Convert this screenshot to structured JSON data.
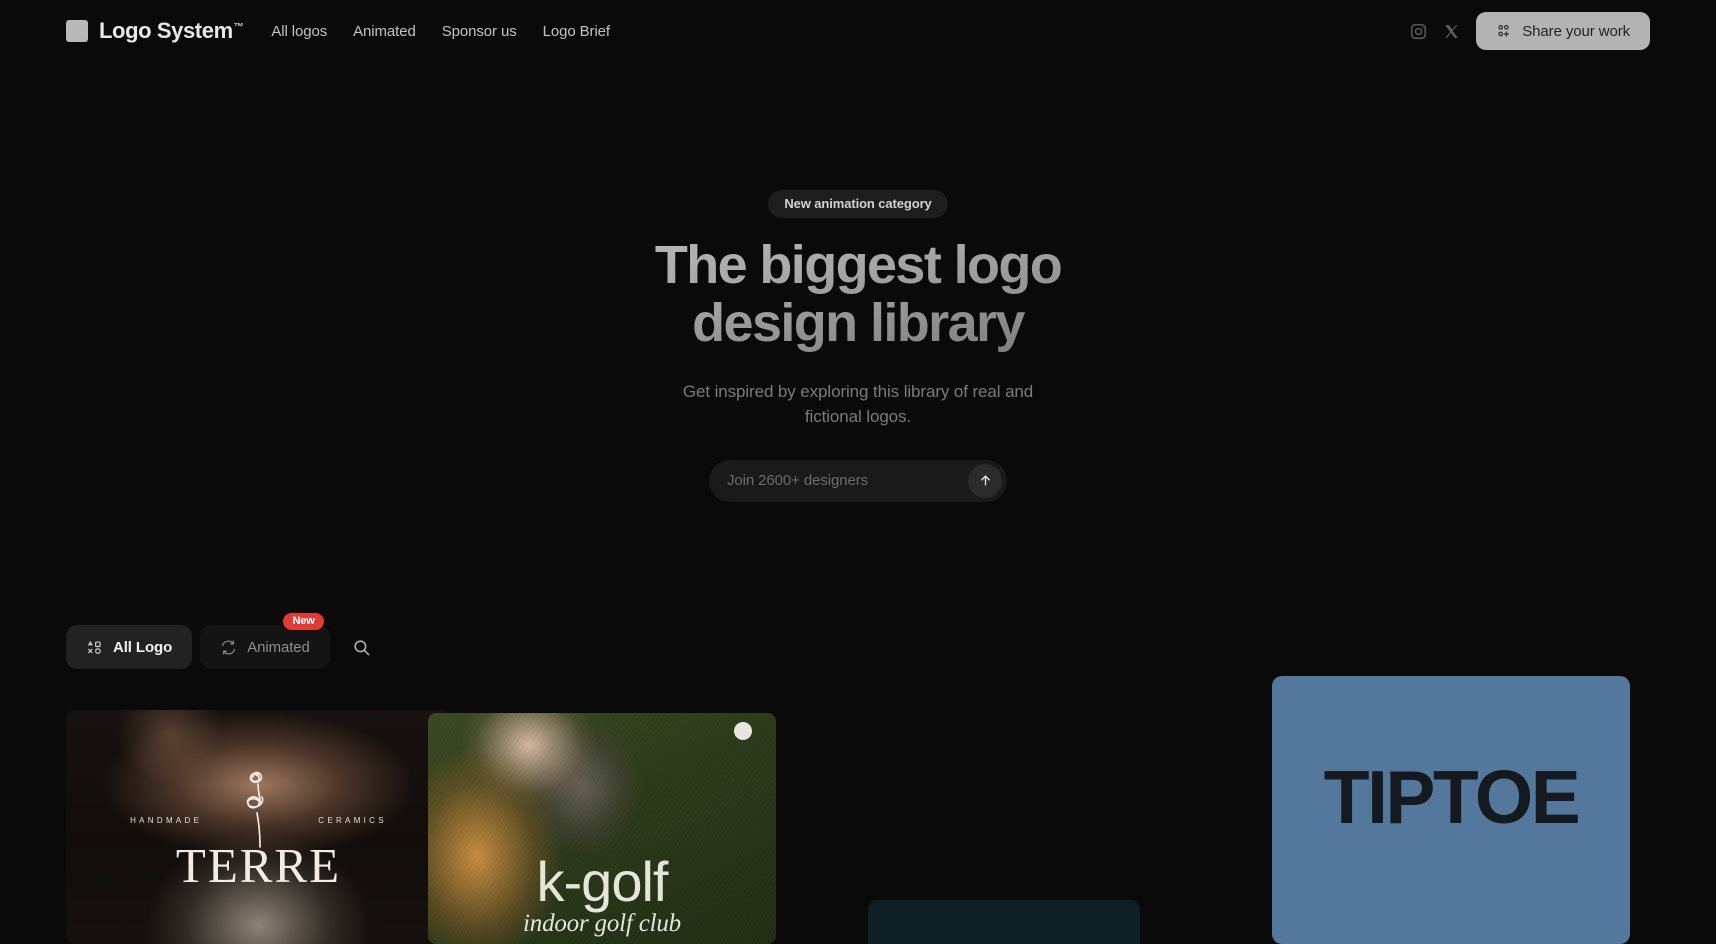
{
  "header": {
    "brand": {
      "name": "Logo System",
      "tm": "™",
      "mark_icon": "square-logo-mark"
    },
    "nav": [
      {
        "label": "All logos"
      },
      {
        "label": "Animated"
      },
      {
        "label": "Sponsor us"
      },
      {
        "label": "Logo Brief"
      }
    ],
    "social": [
      {
        "icon": "instagram-icon",
        "label": "Instagram"
      },
      {
        "icon": "x-twitter-icon",
        "label": "X"
      }
    ],
    "share_button": {
      "label": "Share your work",
      "icon": "user-plus-icon",
      "bg": "#b3b3b3",
      "fg": "#232323"
    }
  },
  "hero": {
    "pill": "New animation category",
    "headline_line1": "The biggest logo",
    "headline_line2": "design library",
    "subhead_line1": "Get inspired by exploring this library of real and",
    "subhead_line2": "fictional logos.",
    "signup": {
      "placeholder": "Join 2600+ designers",
      "value": "",
      "submit_icon": "arrow-up-icon"
    }
  },
  "filters": {
    "tabs": [
      {
        "label": "All Logo",
        "icon": "shapes-grid-icon",
        "active": true,
        "badge": null
      },
      {
        "label": "Animated",
        "icon": "refresh-cycle-icon",
        "active": false,
        "badge": "New"
      }
    ],
    "badge_color": "#e03b36",
    "search": {
      "icon": "search-icon",
      "label": "Search"
    }
  },
  "gallery": {
    "cards": [
      {
        "id": "terre",
        "name": "TERRE",
        "tagline_left": "HANDMADE",
        "tagline_right": "CERAMICS",
        "logo_icon": "flower-doodle-icon",
        "media": "pottery-photo"
      },
      {
        "id": "kgolf",
        "name": "k-golf",
        "tagline": "indoor golf club",
        "media": "golf-grass-photo"
      },
      {
        "id": "teal-card",
        "name": "",
        "bg": "#0d2125"
      },
      {
        "id": "tiptoe",
        "name": "TIPTOE",
        "bg": "#54789b",
        "fg": "#141a20"
      }
    ]
  }
}
